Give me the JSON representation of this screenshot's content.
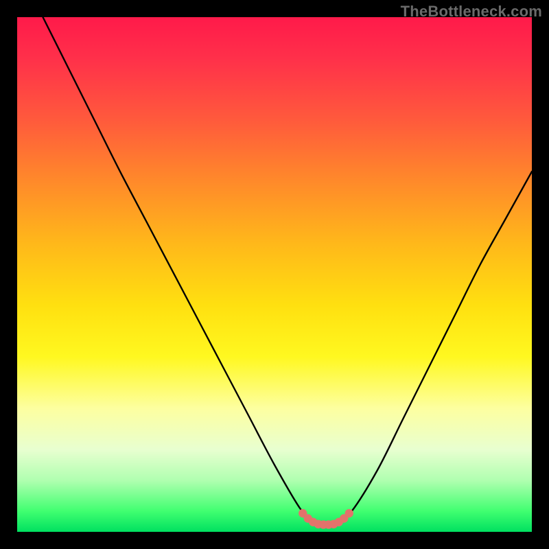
{
  "watermark": "TheBottleneck.com",
  "colors": {
    "frame": "#000000",
    "gradient_top": "#ff1a4a",
    "gradient_bottom": "#00e060",
    "curve": "#000000",
    "marker": "#e2736b",
    "watermark": "#6a6a6a"
  },
  "chart_data": {
    "type": "line",
    "title": "",
    "xlabel": "",
    "ylabel": "",
    "xlim": [
      0,
      100
    ],
    "ylim": [
      0,
      100
    ],
    "series": [
      {
        "name": "bottleneck-curve",
        "x": [
          5,
          10,
          15,
          20,
          25,
          30,
          35,
          40,
          45,
          50,
          55,
          58,
          62,
          65,
          70,
          75,
          80,
          85,
          90,
          95,
          100
        ],
        "values": [
          100,
          90,
          80,
          70,
          60.5,
          51,
          41.5,
          32,
          22.5,
          13,
          4.5,
          1.5,
          1.5,
          4,
          12,
          22,
          32,
          42,
          52,
          61,
          70
        ]
      }
    ],
    "markers": {
      "name": "trough-highlight",
      "x": [
        55.5,
        56.5,
        57.5,
        58.5,
        59.5,
        60.5,
        61.5,
        62.5,
        63.5,
        64.5
      ],
      "values": [
        3.6,
        2.6,
        1.9,
        1.5,
        1.4,
        1.4,
        1.5,
        1.9,
        2.6,
        3.6
      ]
    },
    "legend": false,
    "grid": false
  }
}
